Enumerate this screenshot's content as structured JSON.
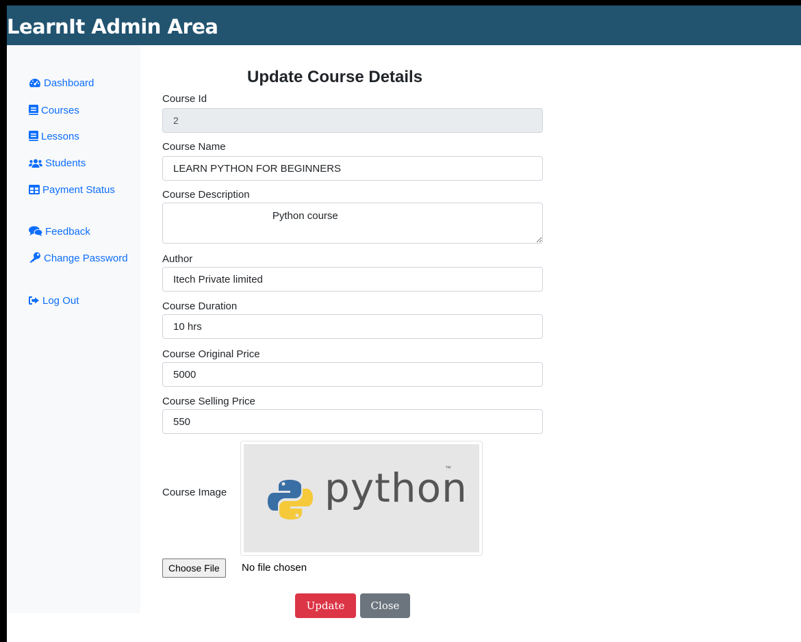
{
  "header": {
    "brand": "LearnIt Admin Area"
  },
  "sidebar": {
    "items": [
      {
        "label": "Dashboard",
        "icon": "tachometer-icon"
      },
      {
        "label": "Courses",
        "icon": "book-icon"
      },
      {
        "label": "Lessons",
        "icon": "book-icon"
      },
      {
        "label": "Students",
        "icon": "users-icon"
      },
      {
        "label": "Payment Status",
        "icon": "table-icon"
      },
      {
        "label": "Feedback",
        "icon": "comments-icon"
      },
      {
        "label": "Change Password",
        "icon": "key-icon"
      },
      {
        "label": "Log Out",
        "icon": "sign-out-icon"
      }
    ]
  },
  "form": {
    "title": "Update Course Details",
    "course_id": {
      "label": "Course Id",
      "value": "2"
    },
    "course_name": {
      "label": "Course Name",
      "value": "LEARN PYTHON FOR BEGINNERS"
    },
    "course_desc": {
      "label": "Course Description",
      "value": "                                   Python course"
    },
    "author": {
      "label": "Author",
      "value": "Itech Private limited"
    },
    "duration": {
      "label": "Course Duration",
      "value": "10 hrs"
    },
    "original_price": {
      "label": "Course Original Price",
      "value": "5000"
    },
    "selling_price": {
      "label": "Course Selling Price",
      "value": "550"
    },
    "image": {
      "label": "Course Image",
      "logo_text": "python",
      "logo_tm": "™"
    },
    "file": {
      "button": "Choose File",
      "status": "No file chosen"
    },
    "buttons": {
      "update": "Update",
      "close": "Close"
    }
  },
  "colors": {
    "header_bg": "#225470",
    "link": "#0d6efd",
    "update_btn": "#dc3545",
    "close_btn": "#6c757d"
  }
}
